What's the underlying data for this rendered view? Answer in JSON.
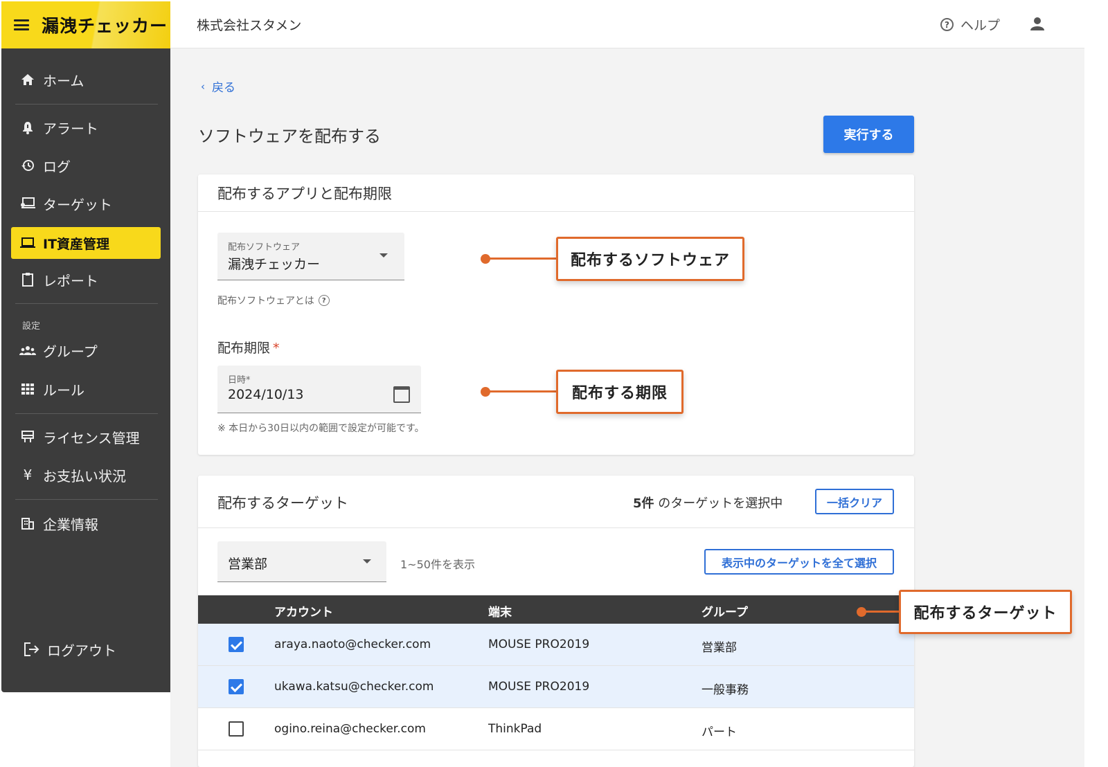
{
  "app": {
    "brand_title": "漏洩チェッカー",
    "company": "株式会社スタメン",
    "help_label": "ヘルプ"
  },
  "sidebar": {
    "items": [
      {
        "label": "ホーム",
        "icon": "home-icon"
      },
      {
        "label": "アラート",
        "icon": "bell-icon"
      },
      {
        "label": "ログ",
        "icon": "history-icon"
      },
      {
        "label": "ターゲット",
        "icon": "computer-user-icon"
      },
      {
        "label": "IT資産管理",
        "icon": "laptop-icon",
        "active": true
      },
      {
        "label": "レポート",
        "icon": "clipboard-icon"
      },
      {
        "label": "グループ",
        "icon": "group-icon"
      },
      {
        "label": "ルール",
        "icon": "grid-icon"
      },
      {
        "label": "ライセンス管理",
        "icon": "license-icon"
      },
      {
        "label": "お支払い状況",
        "icon": "yen-icon"
      },
      {
        "label": "企業情報",
        "icon": "building-icon"
      }
    ],
    "section_settings": "設定",
    "logout_label": "ログアウト"
  },
  "page": {
    "back_label": "戻る",
    "title": "ソフトウェアを配布する",
    "run_button": "実行する"
  },
  "app_card": {
    "title": "配布するアプリと配布期限",
    "software_label": "配布ソフトウェア",
    "software_value": "漏洩チェッカー",
    "software_help": "配布ソフトウェアとは",
    "period_label": "配布期限",
    "required_mark": "*",
    "date_label": "日時*",
    "date_value": "2024/10/13",
    "date_note": "※ 本日から30日以内の範囲で設定が可能です。"
  },
  "target_card": {
    "title": "配布するターゲット",
    "selected_count": "5件",
    "selected_suffix": " のターゲットを選択中",
    "clear_button": "一括クリア",
    "group_filter": "営業部",
    "range_text": "1~50件を表示",
    "select_all_button": "表示中のターゲットを全て選択",
    "columns": [
      "アカウント",
      "端末",
      "グループ"
    ],
    "rows": [
      {
        "checked": true,
        "account": "araya.naoto@checker.com",
        "device": "MOUSE PRO2019",
        "group": "営業部"
      },
      {
        "checked": true,
        "account": "ukawa.katsu@checker.com",
        "device": "MOUSE PRO2019",
        "group": "一般事務"
      },
      {
        "checked": false,
        "account": "ogino.reina@checker.com",
        "device": "ThinkPad",
        "group": "パート"
      }
    ]
  },
  "callouts": {
    "software": "配布するソフトウェア",
    "period": "配布する期限",
    "target": "配布するターゲット"
  },
  "colors": {
    "brand_yellow": "#f8d91b",
    "sidebar_bg": "#3c3c3c",
    "primary_blue": "#2d79e8",
    "callout_orange": "#e06a2c",
    "selected_row": "#e8f1fd"
  }
}
